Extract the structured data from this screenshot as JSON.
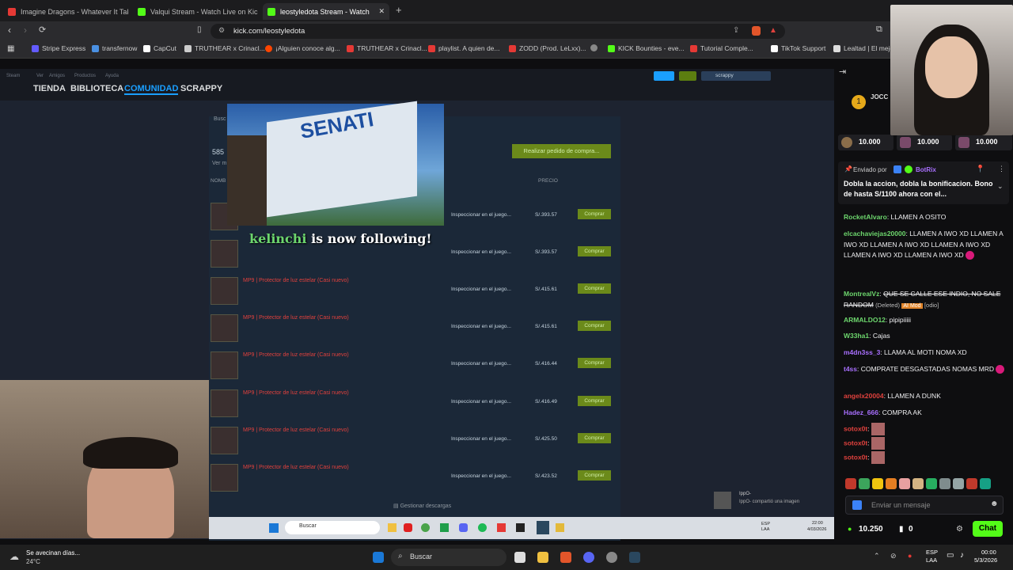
{
  "browser": {
    "tabs": [
      {
        "label": "Imagine Dragons - Whatever It Takes",
        "color": "#e53935"
      },
      {
        "label": "Valqui Stream - Watch Live on Kick",
        "color": "#53fc18"
      },
      {
        "label": "leostyledota Stream - Watch",
        "color": "#53fc18"
      }
    ],
    "url": "kick.com/leostyledota",
    "bookmarks": [
      {
        "label": "Stripe Express",
        "color": "#635bff"
      },
      {
        "label": "transfernow",
        "color": "#4a90e2"
      },
      {
        "label": "CapCut",
        "color": "#ffffff"
      },
      {
        "label": "TRUTHEAR x Crinacl...",
        "color": "#cccccc"
      },
      {
        "label": "¡Alguien conoce alg...",
        "color": "#ff4500"
      },
      {
        "label": "TRUTHEAR x Crinacl...",
        "color": "#e53935"
      },
      {
        "label": "playlist. A quien de...",
        "color": "#e53935"
      },
      {
        "label": "ZODD (Prod. LeLxx)...",
        "color": "#e53935"
      },
      {
        "label": "",
        "color": "#888888"
      },
      {
        "label": "KICK Bounties - eve...",
        "color": "#53fc18"
      },
      {
        "label": "Tutorial Comple...",
        "color": "#e53935"
      },
      {
        "label": "TikTok Support",
        "color": "#ffffff"
      },
      {
        "label": "Lealtad | El mejo",
        "color": "#dddddd"
      }
    ]
  },
  "stream": {
    "steam_nav": [
      "TIENDA",
      "BIBLIOTECA",
      "COMUNIDAD",
      "SCRAPPY"
    ],
    "steam_menu": [
      "Steam",
      "Ver",
      "Amigos",
      "Productos",
      "Ayuda"
    ],
    "steam_user": "scrappy",
    "place_order": "Realizar pedido de compra...",
    "price_header": "PRECIO",
    "listing_count": "585",
    "see_more": "Ver m",
    "name_header": "NOMB",
    "search_label": "Busc",
    "listings": [
      {
        "name": "",
        "inspect": "Inspeccionar en el juego...",
        "price": "S/.393.57",
        "buy": "Comprar"
      },
      {
        "name": "",
        "inspect": "Inspeccionar en el juego...",
        "price": "S/.393.57",
        "buy": "Comprar"
      },
      {
        "name": "MP9 | Protector de luz estelar (Casi nuevo)",
        "inspect": "Inspeccionar en el juego...",
        "price": "S/.415.61",
        "buy": "Comprar"
      },
      {
        "name": "MP9 | Protector de luz estelar (Casi nuevo)",
        "inspect": "Inspeccionar en el juego...",
        "price": "S/.415.61",
        "buy": "Comprar"
      },
      {
        "name": "MP9 | Protector de luz estelar (Casi nuevo)",
        "inspect": "Inspeccionar en el juego...",
        "price": "S/.416.44",
        "buy": "Comprar"
      },
      {
        "name": "MP9 | Protector de luz estelar (Casi nuevo)",
        "inspect": "Inspeccionar en el juego...",
        "price": "S/.416.49",
        "buy": "Comprar"
      },
      {
        "name": "MP9 | Protector de luz estelar (Casi nuevo)",
        "inspect": "Inspeccionar en el juego...",
        "price": "S/.425.50",
        "buy": "Comprar"
      },
      {
        "name": "MP9 | Protector de luz estelar (Casi nuevo)",
        "inspect": "Inspeccionar en el juego...",
        "price": "S/.423.52",
        "buy": "Comprar"
      }
    ],
    "follow_user": "kelinchi",
    "follow_text": " is now following!",
    "senati_sign": "SENATI",
    "downloads": "Gestionar descargas",
    "inner_search": "Buscar",
    "notif_user": "IppO-",
    "notif_text": "IppO- compartió una imagen",
    "inner_lang": "ESP LAA",
    "inner_time": "22:00",
    "inner_date": "4/03/2026"
  },
  "chat": {
    "top_gifter": "JOCC",
    "leaderboard": [
      "10.000",
      "10.000",
      "10.000"
    ],
    "pinned_by_label": "Enviado por",
    "pinned_by": "BotRix",
    "pinned_text": "Dobla la accion, dobla la bonificacion. Bono de hasta S/1100 ahora con el...",
    "messages": [
      {
        "user": "RocketAlvaro",
        "color": "#6dd66d",
        "text": "LLAMEN A OSITO"
      },
      {
        "user": "elcachaviejas20000",
        "color": "#6dd66d",
        "text": "LLAMEN A IWO XD  LLAMEN A IWO XD  LLAMEN A IWO XD  LLAMEN A IWO XD  LLAMEN A IWO XD  LLAMEN A IWO XD"
      },
      {
        "user": "MontrealVz",
        "color": "#6dd66d",
        "text": "QUE SE CALLE ESE INDIO, NO SALE RANDOM"
      },
      {
        "user": "ARMALDO12",
        "color": "#6dd66d",
        "text": "pipipiiiii"
      },
      {
        "user": "W33ha1",
        "color": "#6dd66d",
        "text": "Cajas"
      },
      {
        "user": "m4dn3ss_3",
        "color": "#a970ff",
        "text": "LLAMA AL MOTI NOMA XD"
      },
      {
        "user": "t4ss",
        "color": "#a970ff",
        "text": "COMPRATE DESGASTADAS NOMAS MRD"
      },
      {
        "user": "angelx20004",
        "color": "#e0413d",
        "text": "LLAMEN A DUNK"
      },
      {
        "user": "Hadez_666",
        "color": "#a970ff",
        "text": "COMPRA AK"
      },
      {
        "user": "sotox0t",
        "color": "#e0413d",
        "text": ""
      },
      {
        "user": "sotox0t",
        "color": "#e0413d",
        "text": ""
      },
      {
        "user": "sotox0t",
        "color": "#e0413d",
        "text": ""
      }
    ],
    "deleted_label": "(Deleted)",
    "mod_badge": "AI Mod",
    "mod_reason": "[odio]",
    "input_placeholder": "Enviar un mensaje",
    "points": "10.250",
    "kicks": "0",
    "chat_button": "Chat",
    "accent": "#53fc18"
  },
  "taskbar": {
    "weather_title": "Se avecinan días...",
    "temperature": "24°C",
    "search": "Buscar",
    "lang": "ESP",
    "lang2": "LAA",
    "time": "00:00",
    "date": "5/3/2026"
  }
}
